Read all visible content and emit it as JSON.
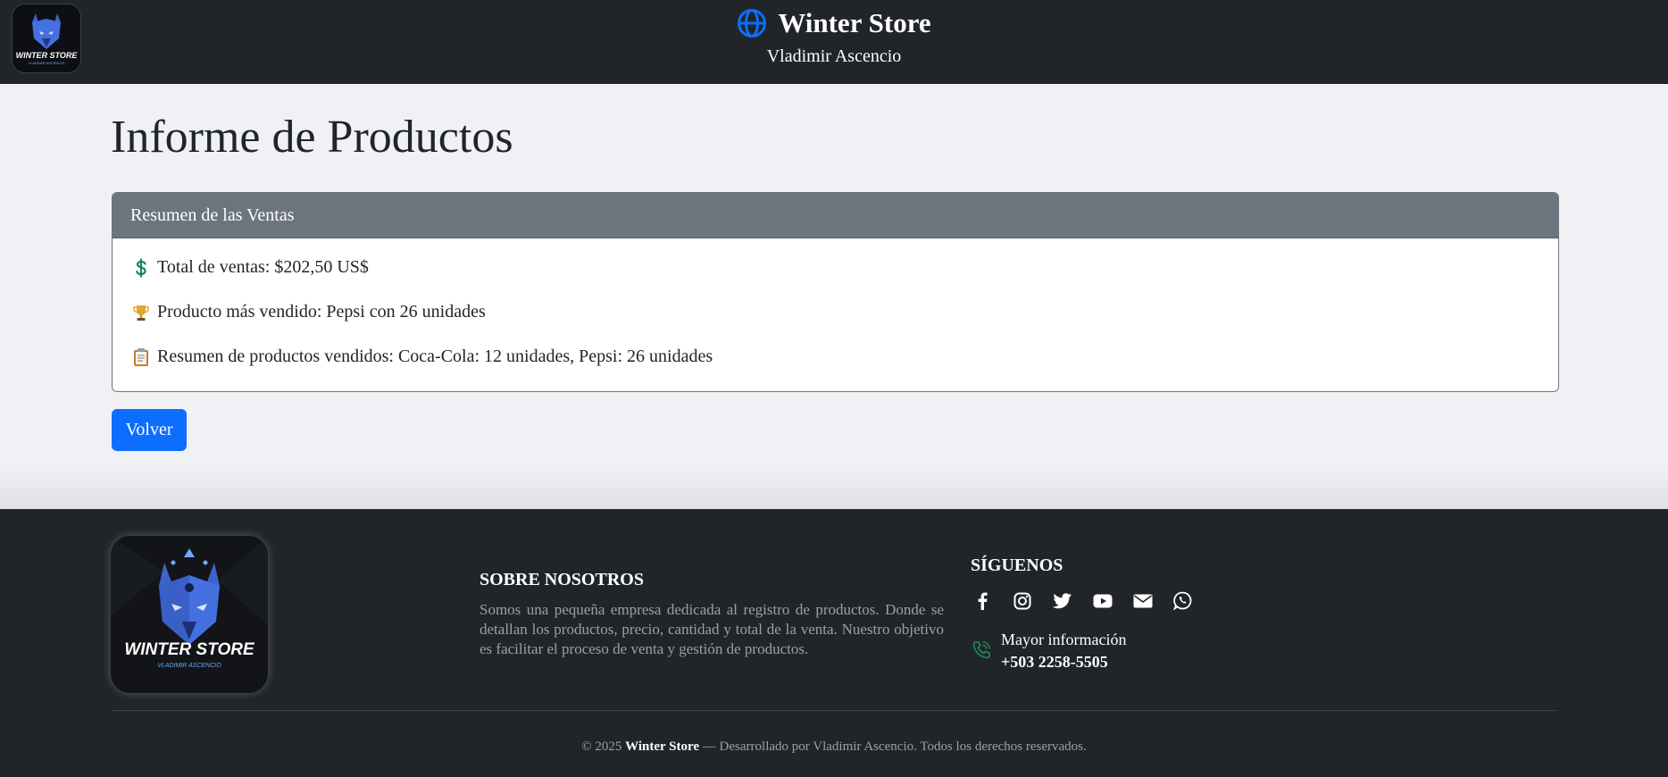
{
  "header": {
    "brand_title": "Winter Store",
    "brand_subtitle": "Vladimir Ascencio",
    "logo_text": "WINTER STORE",
    "logo_subtext": "VLADIMIR ASCENCIO",
    "globe_color": "#0d6efd"
  },
  "main": {
    "page_title": "Informe de Productos",
    "summary_card": {
      "header": "Resumen de las Ventas",
      "rows": [
        {
          "icon": "dollar-icon",
          "text": "Total de ventas: $202,50 US$"
        },
        {
          "icon": "trophy-icon",
          "text": "Producto más vendido: Pepsi con 26 unidades"
        },
        {
          "icon": "clipboard-icon",
          "text": "Resumen de productos vendidos: Coca-Cola: 12 unidades, Pepsi: 26 unidades"
        }
      ]
    },
    "back_button": "Volver"
  },
  "footer": {
    "logo_text": "WINTER STORE",
    "logo_subtext": "VLADIMIR ASCENCIO",
    "about_title": "SOBRE NOSOTROS",
    "about_text": "Somos una pequeña empresa dedicada al registro de productos. Donde se detallan los productos, precio, cantidad y total de la venta. Nuestro objetivo es facilitar el proceso de venta y gestión de productos.",
    "follow_title": "SÍGUENOS",
    "social": [
      "facebook-icon",
      "instagram-icon",
      "twitter-icon",
      "youtube-icon",
      "email-icon",
      "whatsapp-icon"
    ],
    "info_label": "Mayor información",
    "info_phone": "+503 2258-5505",
    "copyright_prefix": "© 2025",
    "copyright_brand": "Winter Store",
    "copyright_suffix": "— Desarrollado por Vladimir Ascencio. Todos los derechos reservados."
  },
  "colors": {
    "dark": "#212529",
    "primary": "#0d6efd",
    "card_header": "#6c757d",
    "success": "#198754"
  }
}
